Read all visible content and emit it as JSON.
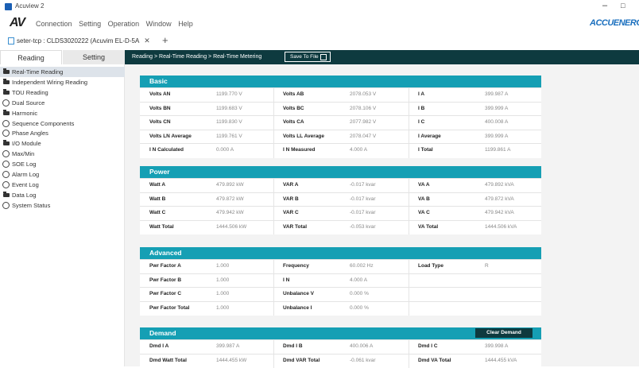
{
  "window": {
    "title": "Acuview 2",
    "minimize": "–",
    "maximize": "□"
  },
  "menu": {
    "logo": "AV",
    "items": [
      "Connection",
      "Setting",
      "Operation",
      "Window",
      "Help"
    ],
    "brand": "ACCUENERGY"
  },
  "doc_tab": {
    "label": "seter-tcp : CLDS3020222 (Acuvim EL-D-5A",
    "close": "✕",
    "add": "+"
  },
  "side_tabs": {
    "reading": "Reading",
    "setting": "Setting"
  },
  "nav": [
    {
      "label": "Real-Time Reading",
      "icon": "folder",
      "selected": true
    },
    {
      "label": "Independent Wiring Reading",
      "icon": "folder",
      "selected": false
    },
    {
      "label": "TOU Reading",
      "icon": "folder",
      "selected": false
    },
    {
      "label": "Dual Source",
      "icon": "circle",
      "selected": false
    },
    {
      "label": "Harmonic",
      "icon": "folder",
      "selected": false
    },
    {
      "label": "Sequence Components",
      "icon": "circle",
      "selected": false
    },
    {
      "label": "Phase Angles",
      "icon": "circle",
      "selected": false
    },
    {
      "label": "I/O Module",
      "icon": "folder",
      "selected": false
    },
    {
      "label": "Max/Min",
      "icon": "circle",
      "selected": false
    },
    {
      "label": "SOE Log",
      "icon": "circle",
      "selected": false
    },
    {
      "label": "Alarm Log",
      "icon": "circle",
      "selected": false
    },
    {
      "label": "Event Log",
      "icon": "circle",
      "selected": false
    },
    {
      "label": "Data Log",
      "icon": "folder",
      "selected": false
    },
    {
      "label": "System Status",
      "icon": "circle",
      "selected": false
    }
  ],
  "breadcrumb": "Reading > Real-Time Reading > Real-Time Metering",
  "save_to_file": "Save To File",
  "panels": {
    "basic": {
      "title": "Basic",
      "rows": [
        [
          [
            "Volts AN",
            "1199.770 V"
          ],
          [
            "Volts AB",
            "2078.053 V"
          ],
          [
            "I A",
            "399.987 A"
          ]
        ],
        [
          [
            "Volts BN",
            "1199.683 V"
          ],
          [
            "Volts BC",
            "2078.106 V"
          ],
          [
            "I B",
            "399.999 A"
          ]
        ],
        [
          [
            "Volts CN",
            "1199.830 V"
          ],
          [
            "Volts CA",
            "2077.982 V"
          ],
          [
            "I C",
            "400.008 A"
          ]
        ],
        [
          [
            "Volts LN Average",
            "1199.761 V"
          ],
          [
            "Volts LL Average",
            "2078.047 V"
          ],
          [
            "I Average",
            "399.999 A"
          ]
        ],
        [
          [
            "I N Calculated",
            "0.000 A"
          ],
          [
            "I N Measured",
            "4.000 A"
          ],
          [
            "I Total",
            "1199.861 A"
          ]
        ]
      ]
    },
    "power": {
      "title": "Power",
      "rows": [
        [
          [
            "Watt A",
            "479.892 kW"
          ],
          [
            "VAR A",
            "-0.017 kvar"
          ],
          [
            "VA A",
            "479.892 kVA"
          ]
        ],
        [
          [
            "Watt B",
            "479.872 kW"
          ],
          [
            "VAR B",
            "-0.017 kvar"
          ],
          [
            "VA B",
            "479.872 kVA"
          ]
        ],
        [
          [
            "Watt C",
            "479.942 kW"
          ],
          [
            "VAR C",
            "-0.017 kvar"
          ],
          [
            "VA C",
            "479.942 kVA"
          ]
        ],
        [
          [
            "Watt Total",
            "1444.506 kW"
          ],
          [
            "VAR Total",
            "-0.053 kvar"
          ],
          [
            "VA Total",
            "1444.506 kVA"
          ]
        ]
      ]
    },
    "advanced": {
      "title": "Advanced",
      "rows": [
        [
          [
            "Pwr Factor A",
            "1.000"
          ],
          [
            "Frequency",
            "60.002 Hz"
          ],
          [
            "Load Type",
            "R"
          ]
        ],
        [
          [
            "Pwr Factor B",
            "1.000"
          ],
          [
            "I N",
            "4.000 A"
          ],
          [
            "",
            ""
          ]
        ],
        [
          [
            "Pwr Factor C",
            "1.000"
          ],
          [
            "Unbalance V",
            "0.000 %"
          ],
          [
            "",
            ""
          ]
        ],
        [
          [
            "Pwr Factor Total",
            "1.000"
          ],
          [
            "Unbalance I",
            "0.000 %"
          ],
          [
            "",
            ""
          ]
        ]
      ]
    },
    "demand": {
      "title": "Demand",
      "clear_label": "Clear Demand",
      "rows": [
        [
          [
            "Dmd I A",
            "399.987 A"
          ],
          [
            "Dmd I B",
            "400.006 A"
          ],
          [
            "Dmd I C",
            "399.998 A"
          ]
        ],
        [
          [
            "Dmd Watt Total",
            "1444.455 kW"
          ],
          [
            "Dmd VAR Total",
            "-0.061 kvar"
          ],
          [
            "Dmd VA Total",
            "1444.455 kVA"
          ]
        ]
      ]
    }
  }
}
